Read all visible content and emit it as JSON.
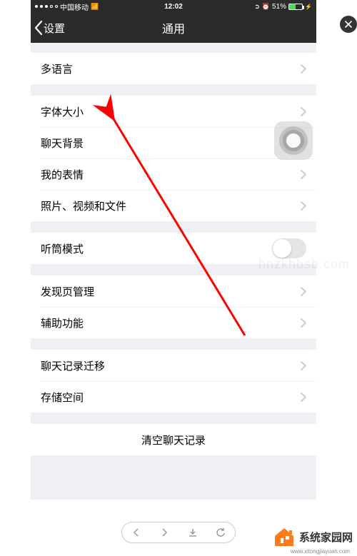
{
  "status": {
    "carrier": "中国移动",
    "time": "12:02",
    "battery_pct": "51%"
  },
  "nav": {
    "back_label": "设置",
    "title": "通用"
  },
  "groups": [
    {
      "cells": [
        {
          "label": "多语言",
          "type": "disclosure"
        }
      ]
    },
    {
      "cells": [
        {
          "label": "字体大小",
          "type": "disclosure"
        },
        {
          "label": "聊天背景",
          "type": "disclosure"
        },
        {
          "label": "我的表情",
          "type": "disclosure"
        },
        {
          "label": "照片、视频和文件",
          "type": "disclosure"
        }
      ]
    },
    {
      "cells": [
        {
          "label": "听筒模式",
          "type": "switch",
          "on": false
        }
      ]
    },
    {
      "cells": [
        {
          "label": "发现页管理",
          "type": "disclosure"
        },
        {
          "label": "辅助功能",
          "type": "disclosure"
        }
      ]
    },
    {
      "cells": [
        {
          "label": "聊天记录迁移",
          "type": "disclosure"
        },
        {
          "label": "存储空间",
          "type": "disclosure"
        }
      ]
    }
  ],
  "clear_label": "清空聊天记录",
  "watermark_faint": "hnzkhbsb.com",
  "brand": {
    "name": "系统家园网",
    "url": "www.xitongjiayuan.com"
  },
  "colors": {
    "accent_red": "#ff0000",
    "house": "#ff7a1a"
  }
}
